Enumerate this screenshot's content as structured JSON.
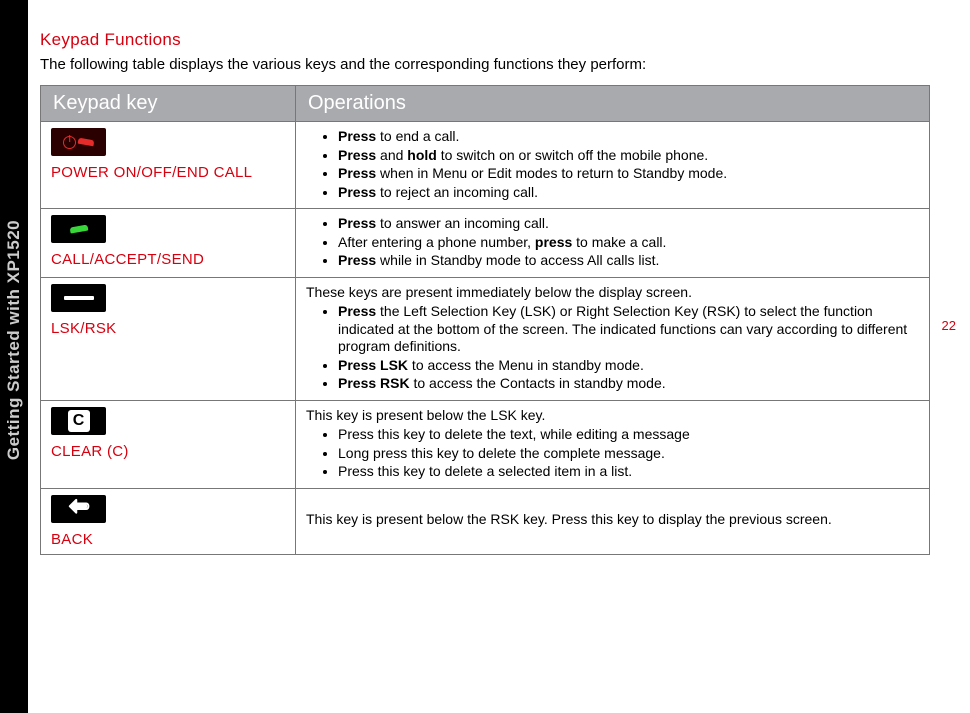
{
  "sidebar_label": "Getting Started with XP1520",
  "heading": "Keypad Functions",
  "intro": "The following table displays the various keys and the corresponding functions they perform:",
  "page_number": "22",
  "table_header": {
    "col1": "Keypad key",
    "col2": "Operations"
  },
  "rows": [
    {
      "name": "POWER ON/OFF/END CALL",
      "pre": "",
      "items": [
        "<b>Press</b> to end a call.",
        "<b>Press</b> and <b>hold</b> to switch on or switch off the mobile phone.",
        "<b>Press</b> when in Menu or Edit modes to return to Standby mode.",
        "<b>Press</b> to reject an incoming call."
      ]
    },
    {
      "name": "CALL/ACCEPT/SEND",
      "pre": "",
      "items": [
        "<b>Press</b> to answer an incoming call.",
        "After entering a phone number, <b>press</b> to make a call.",
        "<b>Press</b> while in Standby mode to access All calls list."
      ]
    },
    {
      "name": "LSK/RSK",
      "pre": "These keys are present immediately below the display screen.",
      "items": [
        "<b>Press</b> the Left Selection Key (LSK) or Right Selection Key (RSK) to select the function indicated at the bottom of the screen. The indicated functions can vary according to different program definitions.",
        "<b>Press LSK</b> to access the Menu in standby mode.",
        "<b>Press RSK</b> to access the Contacts in standby mode."
      ]
    },
    {
      "name": "CLEAR (C)",
      "pre": "This key is present below the LSK key.",
      "items": [
        "Press this key to delete the text, while editing a message",
        "Long press this key to delete the complete message.",
        "Press this key to delete a selected item in a list."
      ]
    },
    {
      "name": "BACK",
      "pre": "This key is present below the RSK key. Press this key to display the previous screen.",
      "items": []
    }
  ]
}
